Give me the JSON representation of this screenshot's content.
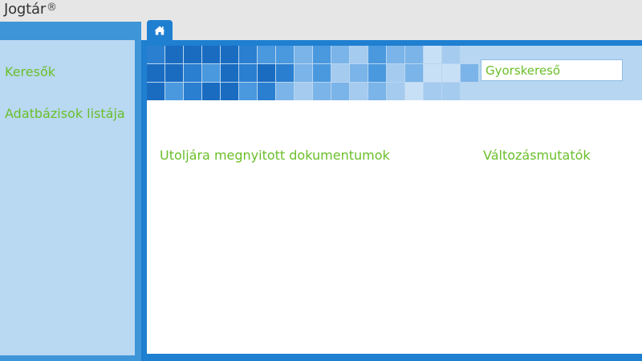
{
  "app": {
    "title": "Jogtár",
    "reg_mark": "®"
  },
  "tabs": [
    {
      "icon": "home-icon"
    }
  ],
  "sidebar": {
    "items": [
      {
        "label": "Keresők"
      },
      {
        "label": "Adatbázisok listája"
      }
    ]
  },
  "search": {
    "placeholder": "Gyorskereső"
  },
  "main": {
    "recent_documents_heading": "Utoljára megnyitott dokumentumok",
    "change_indicators_heading": "Változásmutatók"
  },
  "colors": {
    "accent_green": "#6abf29",
    "frame_blue": "#1f7fd0",
    "sidebar_blue": "#b9d8f2",
    "banner_blue": "#b7d6f1"
  }
}
